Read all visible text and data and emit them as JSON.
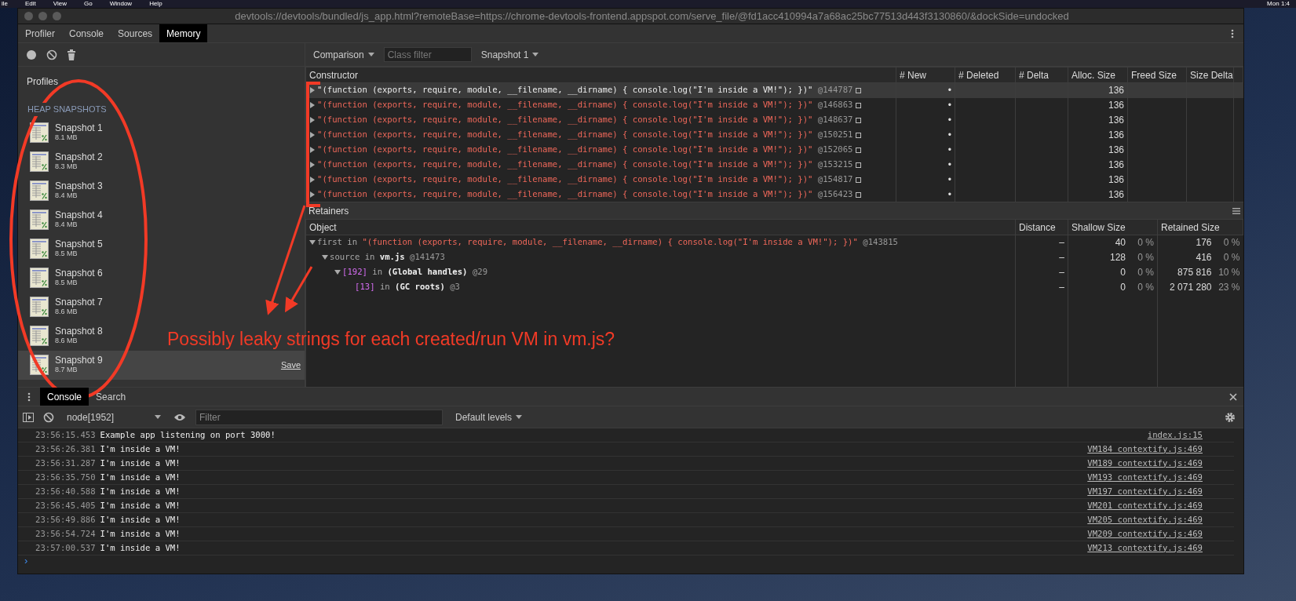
{
  "menu_bar": {
    "items": [
      "ile",
      "Edit",
      "View",
      "Go",
      "Window",
      "Help"
    ],
    "clock": "Mon 1:4"
  },
  "window": {
    "title": "devtools://devtools/bundled/js_app.html?remoteBase=https://chrome-devtools-frontend.appspot.com/serve_file/@fd1acc410994a7a68ac25bc77513d443f3130860/&dockSide=undocked"
  },
  "tabs": [
    {
      "label": "Profiler",
      "selected": false
    },
    {
      "label": "Console",
      "selected": false
    },
    {
      "label": "Sources",
      "selected": false
    },
    {
      "label": "Memory",
      "selected": true
    }
  ],
  "profiles_panel": {
    "title": "Profiles",
    "section": "HEAP SNAPSHOTS",
    "save_link": "Save",
    "snapshots": [
      {
        "name": "Snapshot 1",
        "size": "8.1 MB",
        "selected": false
      },
      {
        "name": "Snapshot 2",
        "size": "8.3 MB",
        "selected": false
      },
      {
        "name": "Snapshot 3",
        "size": "8.4 MB",
        "selected": false
      },
      {
        "name": "Snapshot 4",
        "size": "8.4 MB",
        "selected": false
      },
      {
        "name": "Snapshot 5",
        "size": "8.5 MB",
        "selected": false
      },
      {
        "name": "Snapshot 6",
        "size": "8.5 MB",
        "selected": false
      },
      {
        "name": "Snapshot 7",
        "size": "8.6 MB",
        "selected": false
      },
      {
        "name": "Snapshot 8",
        "size": "8.6 MB",
        "selected": false
      },
      {
        "name": "Snapshot 9",
        "size": "8.7 MB",
        "selected": true
      }
    ]
  },
  "toolbar": {
    "view": "Comparison",
    "filter_placeholder": "Class filter",
    "base": "Snapshot 1"
  },
  "constructor_table": {
    "columns": [
      "Constructor",
      "# New",
      "# Deleted",
      "# Delta",
      "Alloc. Size",
      "Freed Size",
      "Size Delta"
    ],
    "rows": [
      {
        "name": "\"(function (exports, require, module, __filename, __dirname) { console.log(\"I'm inside a VM!\"); })\"",
        "id": "@144787",
        "new": "•",
        "alloc": "136",
        "expanded": false,
        "selected": true
      },
      {
        "name": "\"(function (exports, require, module, __filename, __dirname) { console.log(\"I'm inside a VM!\"); })\"",
        "id": "@146863",
        "new": "•",
        "alloc": "136",
        "expanded": false,
        "selected": false
      },
      {
        "name": "\"(function (exports, require, module, __filename, __dirname) { console.log(\"I'm inside a VM!\"); })\"",
        "id": "@148637",
        "new": "•",
        "alloc": "136",
        "expanded": false,
        "selected": false
      },
      {
        "name": "\"(function (exports, require, module, __filename, __dirname) { console.log(\"I'm inside a VM!\"); })\"",
        "id": "@150251",
        "new": "•",
        "alloc": "136",
        "expanded": false,
        "selected": false
      },
      {
        "name": "\"(function (exports, require, module, __filename, __dirname) { console.log(\"I'm inside a VM!\"); })\"",
        "id": "@152065",
        "new": "•",
        "alloc": "136",
        "expanded": false,
        "selected": false
      },
      {
        "name": "\"(function (exports, require, module, __filename, __dirname) { console.log(\"I'm inside a VM!\"); })\"",
        "id": "@153215",
        "new": "•",
        "alloc": "136",
        "expanded": false,
        "selected": false
      },
      {
        "name": "\"(function (exports, require, module, __filename, __dirname) { console.log(\"I'm inside a VM!\"); })\"",
        "id": "@154817",
        "new": "•",
        "alloc": "136",
        "expanded": false,
        "selected": false
      },
      {
        "name": "\"(function (exports, require, module, __filename, __dirname) { console.log(\"I'm inside a VM!\"); })\"",
        "id": "@156423",
        "new": "•",
        "alloc": "136",
        "expanded": false,
        "selected": false
      }
    ]
  },
  "retainers": {
    "title": "Retainers",
    "columns": [
      "Object",
      "Distance",
      "Shallow Size",
      "Retained Size"
    ],
    "rows": [
      {
        "field": {
          "text": "first",
          "kind": "property"
        },
        "connector": "in",
        "name": {
          "text": "\"(function (exports, require, module, __filename, __dirname) { console.log(\"I'm inside a VM!\"); })\"",
          "kind": "string"
        },
        "id": "@143815",
        "distance": "–",
        "shallow": "40",
        "shallow_pct": "0 %",
        "retained": "176",
        "retained_pct": "0 %",
        "expanded": true,
        "children": [
          {
            "field": {
              "text": "source",
              "kind": "property"
            },
            "connector": "in",
            "name": {
              "text": "vm.js",
              "kind": "object"
            },
            "id": "@141473",
            "distance": "–",
            "shallow": "128",
            "shallow_pct": "0 %",
            "retained": "416",
            "retained_pct": "0 %",
            "expanded": true,
            "children": [
              {
                "field": {
                  "text": "[192]",
                  "kind": "element"
                },
                "connector": "in",
                "name": {
                  "text": "(Global handles)",
                  "kind": "object"
                },
                "id": "@29",
                "distance": "–",
                "shallow": "0",
                "shallow_pct": "0 %",
                "retained": "875 816",
                "retained_pct": "10 %",
                "expanded": true,
                "children": [
                  {
                    "field": {
                      "text": "[13]",
                      "kind": "element"
                    },
                    "connector": "in",
                    "name": {
                      "text": "(GC roots)",
                      "kind": "object"
                    },
                    "id": "@3",
                    "distance": "–",
                    "shallow": "0",
                    "shallow_pct": "0 %",
                    "retained": "2 071 280",
                    "retained_pct": "23 %"
                  }
                ]
              }
            ]
          }
        ]
      }
    ]
  },
  "annotation": {
    "text": "Possibly leaky strings for each created/run VM in vm.js?"
  },
  "drawer": {
    "tabs": [
      {
        "label": "Console",
        "selected": true
      },
      {
        "label": "Search",
        "selected": false
      }
    ],
    "context": "node[1952]",
    "filter_placeholder": "Filter",
    "levels": "Default levels",
    "messages": [
      {
        "time": "23:56:15.453",
        "text": "Example app listening on port 3000!",
        "source": "index.js:15"
      },
      {
        "time": "23:56:26.381",
        "text": "I'm inside a VM!",
        "source": "VM184 contextify.js:469"
      },
      {
        "time": "23:56:31.287",
        "text": "I'm inside a VM!",
        "source": "VM189 contextify.js:469"
      },
      {
        "time": "23:56:35.750",
        "text": "I'm inside a VM!",
        "source": "VM193 contextify.js:469"
      },
      {
        "time": "23:56:40.588",
        "text": "I'm inside a VM!",
        "source": "VM197 contextify.js:469"
      },
      {
        "time": "23:56:45.405",
        "text": "I'm inside a VM!",
        "source": "VM201 contextify.js:469"
      },
      {
        "time": "23:56:49.886",
        "text": "I'm inside a VM!",
        "source": "VM205 contextify.js:469"
      },
      {
        "time": "23:56:54.724",
        "text": "I'm inside a VM!",
        "source": "VM209 contextify.js:469"
      },
      {
        "time": "23:57:00.537",
        "text": "I'm inside a VM!",
        "source": "VM213 contextify.js:469"
      }
    ],
    "prompt": "›"
  }
}
